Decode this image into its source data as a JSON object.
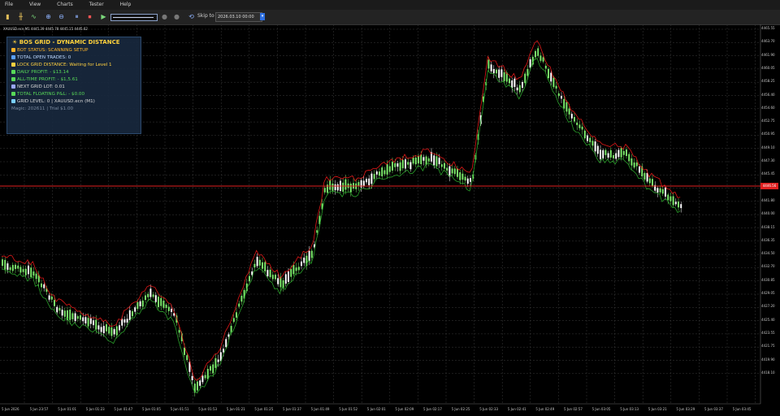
{
  "menu": [
    "File",
    "View",
    "Charts",
    "Tester",
    "Help"
  ],
  "toolbar": {
    "skip_label": "Skip to",
    "skip_value": "2026.03.10 00:00"
  },
  "chart": {
    "symbol_label": "XAUUSD.ecn,M1 4445.39 4445.78 4445.15 4445.62",
    "current_price": "4446.56",
    "y_ticks": [
      "4465.55",
      "4463.70",
      "4461.90",
      "4460.05",
      "4458.25",
      "4456.40",
      "4454.60",
      "4452.75",
      "4450.95",
      "4449.10",
      "4447.30",
      "4445.45",
      "4443.65",
      "4441.80",
      "4440.00",
      "4438.15",
      "4436.35",
      "4434.50",
      "4432.70",
      "4430.85",
      "4429.05",
      "4427.20",
      "4425.40",
      "4423.55",
      "4421.75",
      "4419.90",
      "4418.10"
    ],
    "x_ticks": [
      "5 Jun 2026",
      "5 Jun 23:57",
      "5 Jun 01:01",
      "5 Jun 01:23",
      "5 Jun 01:47",
      "5 Jun 01:05",
      "5 Jun 01:51",
      "5 Jun 01:53",
      "5 Jun 01:21",
      "5 Jun 01:25",
      "5 Jun 01:37",
      "5 Jun 01:49",
      "5 Jun 01:52",
      "5 Jun 02:01",
      "5 Jun 02:09",
      "5 Jun 02:17",
      "5 Jun 02:25",
      "5 Jun 02:33",
      "5 Jun 02:41",
      "5 Jun 02:49",
      "5 Jun 02:57",
      "5 Jun 03:05",
      "5 Jun 03:13",
      "5 Jun 03:21",
      "5 Jun 03:29",
      "5 Jun 03:37",
      "5 Jun 03:45"
    ],
    "colors": {
      "bull": "#7be86a",
      "bear": "#ffffff",
      "line_red": "#e01818",
      "line_green": "#2aa02a",
      "grid": "#3a3a3a",
      "price_line": "#e02020"
    }
  },
  "panel": {
    "title": "BOS GRID - DYNAMIC DISTANCE",
    "rows": [
      {
        "text": "BOT STATUS: SCANNING SETUP",
        "color": "#ffb428",
        "icon": "#ffb428"
      },
      {
        "text": "TOTAL OPEN TRADES: 0",
        "color": "#bcd8ff",
        "icon": "#5aa0ff"
      },
      {
        "text": "LOCK GRID DISTANCE: Waiting for Level 1",
        "color": "#ffd040",
        "icon": "#ffd040"
      },
      {
        "text": "DAILY PROFIT: - $13.14",
        "color": "#58d858",
        "icon": "#58d858"
      },
      {
        "text": "ALL-TIME PROFIT: - $1,5.61",
        "color": "#58d858",
        "icon": "#58d858"
      },
      {
        "text": "NEXT GRID LOT: 0.01",
        "color": "#d8d8d8",
        "icon": "#9aa7ff"
      },
      {
        "text": "TOTAL FLOATING P&L: - $0.00",
        "color": "#58d858",
        "icon": "#58d858"
      },
      {
        "text": "GRID LEVEL: 0 | XAUUSD.ecn (M1)",
        "color": "#d8d8d8",
        "icon": "#7acfff"
      },
      {
        "text": "Magic: 202611 | Trial $1.00",
        "color": "#7a8aa0",
        "icon": ""
      }
    ]
  }
}
